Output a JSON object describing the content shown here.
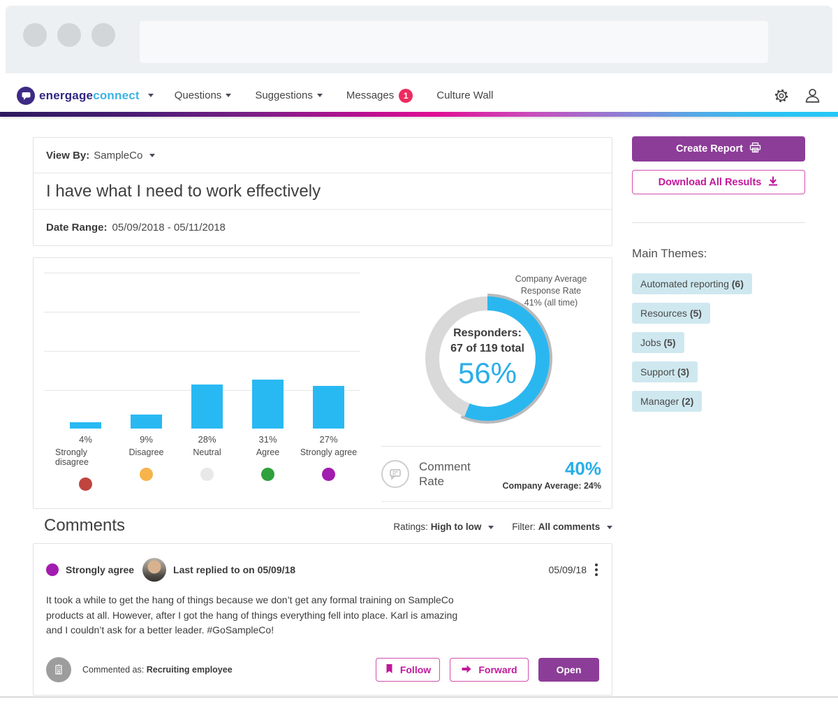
{
  "colors": {
    "purple": "#8c3d98",
    "magenta": "#c2189b",
    "magenta_border": "#d14fae",
    "blue": "#29b9f2",
    "blue_text": "#29aee8",
    "tag_bg": "#cfe8ef",
    "badge": "#ee2b60",
    "brand_dark": "#312783",
    "brand_blue": "#3cb4e5"
  },
  "nav": {
    "brand": {
      "part1": "energage",
      "part2": "connect"
    },
    "items": [
      {
        "label": "Questions"
      },
      {
        "label": "Suggestions"
      },
      {
        "label": "Messages",
        "badge": "1"
      },
      {
        "label": "Culture Wall"
      }
    ],
    "right_icons": [
      "gear",
      "profile"
    ]
  },
  "header_card": {
    "view_by_label": "View By:",
    "view_by_value": "SampleCo",
    "title": "I have what I need to work effectively",
    "date_range_label": "Date Range:",
    "date_range_value": "05/09/2018 - 05/11/2018"
  },
  "chart_data": {
    "type": "bar",
    "categories": [
      "Strongly disagree",
      "Disagree",
      "Neutral",
      "Agree",
      "Strongly agree"
    ],
    "values": [
      4,
      9,
      28,
      31,
      27
    ],
    "value_labels": [
      "4%",
      "9%",
      "28%",
      "31%",
      "27%"
    ],
    "bar_color": "#29b9f2",
    "dot_colors": [
      "#c0443f",
      "#f6b44b",
      "#e8e8e8",
      "#2ea13d",
      "#a21caf"
    ],
    "grid": true,
    "ylabel": "",
    "xlabel": ""
  },
  "donut": {
    "percent": 56,
    "percent_label": "56%",
    "responders_label": "Responders:",
    "responders_value": "67 of 119 total",
    "arc_color": "#2ab7f0",
    "track_color": "#d9d9da",
    "shadow_color": "#b9babc",
    "annotation_line1": "Company Average",
    "annotation_line2": "Response Rate",
    "annotation_line3": "41% (all time)",
    "company_average_percent": 41
  },
  "comment_rate": {
    "icon": "comment-bubble",
    "label_line1": "Comment",
    "label_line2": "Rate",
    "value": "40%",
    "company_average": "Company Average: 24%"
  },
  "actions": {
    "create_report_label": "Create Report",
    "create_report_icon": "printer",
    "download_label": "Download All Results",
    "download_icon": "download-arrow"
  },
  "themes": {
    "heading": "Main Themes:",
    "items": [
      {
        "label": "Automated reporting",
        "count": "(6)"
      },
      {
        "label": "Resources",
        "count": "(5)"
      },
      {
        "label": "Jobs",
        "count": "(5)"
      },
      {
        "label": "Support",
        "count": "(3)"
      },
      {
        "label": "Manager",
        "count": "(2)"
      }
    ]
  },
  "comments": {
    "heading": "Comments",
    "ratings_label": "Ratings:",
    "ratings_value": "High to low",
    "filter_label": "Filter:",
    "filter_value": "All comments",
    "card": {
      "rating": "Strongly agree",
      "rating_color": "#a21caf",
      "replied": "Last replied to on 05/09/18",
      "date": "05/09/18",
      "body": "It took a while to get the hang of things because we don’t get any formal training on SampleCo products at all. However, after I got the hang of things everything fell into place. Karl is amazing and I couldn’t ask for a better leader. #GoSampleCo!",
      "commented_as_label": "Commented as:",
      "commented_as_value": "Recruiting employee",
      "buttons": {
        "follow": "Follow",
        "forward": "Forward",
        "open": "Open"
      }
    }
  }
}
